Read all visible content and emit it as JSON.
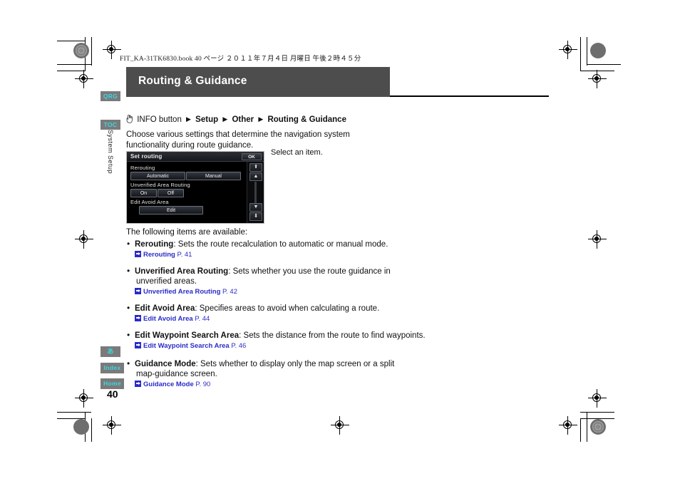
{
  "print": {
    "job_line": "FIT_KA-31TK6830.book   40 ページ   ２０１１年７月４日   月曜日   午後２時４５分"
  },
  "header": {
    "title": "Routing & Guidance"
  },
  "sidebar": {
    "tabs": [
      {
        "label": "QRG"
      },
      {
        "label": "TOC"
      },
      {
        "label": "あ"
      },
      {
        "label": "Index"
      },
      {
        "label": "Home"
      }
    ],
    "section_label": "System Setup",
    "page_number": "40"
  },
  "breadcrumb": {
    "icon": "hand-pointer-icon",
    "start": "INFO button",
    "steps": [
      "Setup",
      "Other",
      "Routing & Guidance"
    ],
    "separator": "▶"
  },
  "intro": "Choose various settings that determine the navigation system functionality during route guidance.",
  "screenshot": {
    "caption": "Select an item.",
    "title": "Set routing",
    "ok_label": "OK",
    "groups": [
      {
        "label": "Rerouting",
        "buttons": [
          "Automatic",
          "Manual"
        ]
      },
      {
        "label": "Unverified Area Routing",
        "buttons": [
          "On",
          "Off"
        ]
      },
      {
        "label": "Edit Avoid Area",
        "buttons": [
          "Edit"
        ]
      }
    ],
    "scroll": {
      "top_label": "⬆",
      "up_label": "▲",
      "down_label": "▼",
      "bottom_label": "⬇"
    }
  },
  "items_intro": "The following items are available:",
  "items": [
    {
      "name": "Rerouting",
      "desc": ": Sets the route recalculation to automatic or manual mode.",
      "desc2": "",
      "ref_name": "Rerouting",
      "ref_page": "P. 41"
    },
    {
      "name": "Unverified Area Routing",
      "desc": ": Sets whether you use the route guidance in",
      "desc2": "unverified areas.",
      "ref_name": "Unverified Area Routing",
      "ref_page": "P. 42"
    },
    {
      "name": "Edit Avoid Area",
      "desc": ": Specifies areas to avoid when calculating a route.",
      "desc2": "",
      "ref_name": "Edit Avoid Area",
      "ref_page": "P. 44"
    },
    {
      "name": "Edit Waypoint Search Area",
      "desc": ": Sets the distance from the route to find waypoints.",
      "desc2": "",
      "ref_name": "Edit Waypoint Search Area",
      "ref_page": "P. 46"
    },
    {
      "name": "Guidance Mode",
      "desc": ": Sets whether to display only the map screen or a split",
      "desc2": "map-guidance screen.",
      "ref_name": "Guidance Mode",
      "ref_page": "P. 90"
    }
  ],
  "colors": {
    "title_bar": "#4d4d4d",
    "tab_bg": "#7a7a7a",
    "tab_text": "#3ad6e0",
    "link": "#2b2bc8"
  }
}
